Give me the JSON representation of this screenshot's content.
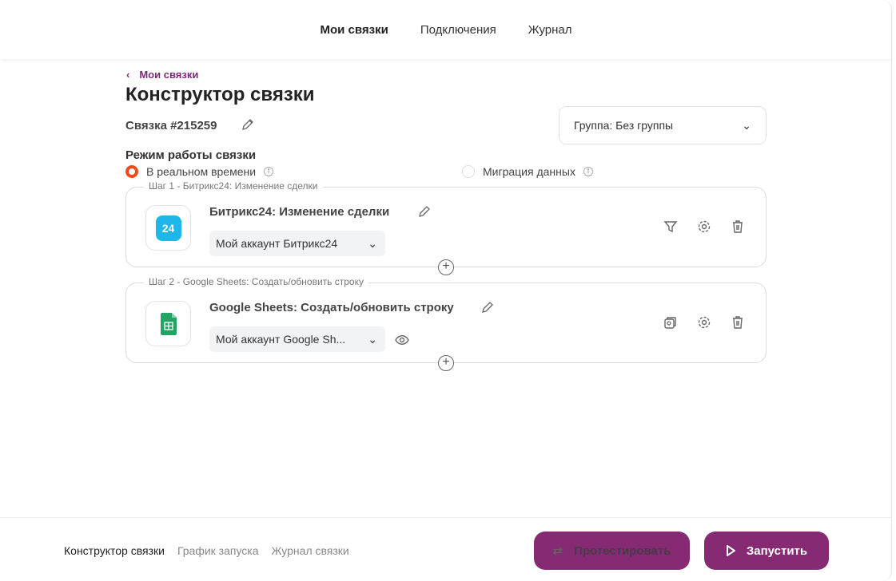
{
  "topnav": {
    "items": [
      "Мои связки",
      "Подключения",
      "Журнал"
    ]
  },
  "breadcrumb": "Мои связки",
  "title": "Конструктор связки",
  "link_id": "Связка #215259",
  "group": "Группа: Без группы",
  "mode": {
    "label": "Режим работы связки",
    "options": [
      "В реальном времени",
      "Миграция данных"
    ],
    "selected": 0
  },
  "steps": [
    {
      "legend": "Шаг 1 - Битрикс24: Изменение сделки",
      "title": "Битрикс24: Изменение сделки",
      "account": "Мой аккаунт Битрикс24",
      "logo_text": "24"
    },
    {
      "legend": "Шаг 2 - Google Sheets: Создать/обновить строку",
      "title": "Google Sheets: Создать/обновить строку",
      "account": "Мой аккаунт Google Sh..."
    }
  ],
  "bottom": {
    "tabs": [
      "Конструктор связки",
      "График запуска",
      "Журнал связки"
    ],
    "test": "Протестировать",
    "run": "Запустить"
  },
  "colors": {
    "accent": "#862a74",
    "radio": "#f24a1a",
    "bitrix": "#1fb7ea",
    "sheets": "#21a464"
  }
}
